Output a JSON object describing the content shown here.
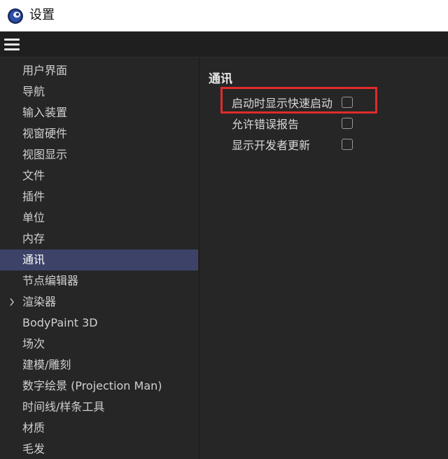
{
  "window": {
    "title": "设置"
  },
  "sidebar": {
    "items": [
      {
        "label": "用户界面"
      },
      {
        "label": "导航"
      },
      {
        "label": "输入装置"
      },
      {
        "label": "视窗硬件"
      },
      {
        "label": "视图显示"
      },
      {
        "label": "文件"
      },
      {
        "label": "插件"
      },
      {
        "label": "单位"
      },
      {
        "label": "内存"
      },
      {
        "label": "通讯",
        "selected": true
      },
      {
        "label": "节点编辑器"
      },
      {
        "label": "渲染器",
        "expandable": true
      },
      {
        "label": "BodyPaint 3D"
      },
      {
        "label": "场次"
      },
      {
        "label": "建模/雕刻"
      },
      {
        "label": "数字绘景 (Projection Man)"
      },
      {
        "label": "时间线/样条工具"
      },
      {
        "label": "材质"
      },
      {
        "label": "毛发"
      }
    ]
  },
  "content": {
    "section_title": "通讯",
    "options": [
      {
        "label": "启动时显示快速启动",
        "checked": false
      },
      {
        "label": "允许错误报告",
        "checked": false
      },
      {
        "label": "显示开发者更新",
        "checked": false
      }
    ]
  },
  "icons": {
    "app": "cinema4d-logo-icon",
    "menu": "hamburger-menu-icon",
    "expand": "chevron-right-icon"
  },
  "colors": {
    "selected_item_bg": "#3d4368",
    "highlight_border": "#e02b2b",
    "panel_bg": "#262626"
  }
}
